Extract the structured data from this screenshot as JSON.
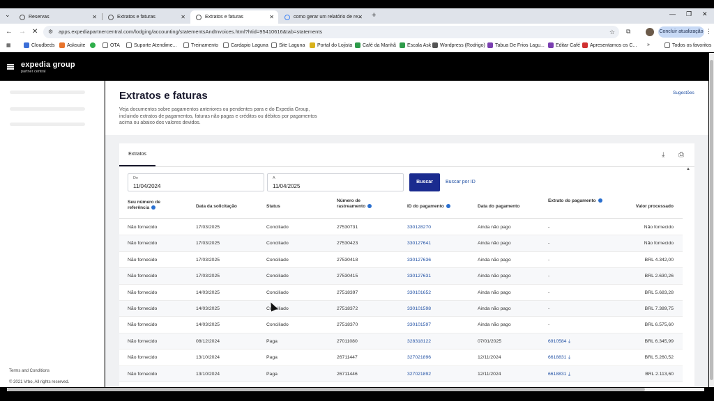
{
  "browser": {
    "tabs": [
      {
        "title": "Reservas"
      },
      {
        "title": "Extratos e faturas"
      },
      {
        "title": "Extratos e faturas"
      },
      {
        "title": "como gerar um relatório de re..."
      }
    ],
    "new_tab_icon": "plus-icon",
    "url": "apps.expediapartnercentral.com/lodging/accounting/statementsAndInvoices.html?htid=95410616&tab=statements",
    "update_button": "Concluir atualização",
    "bookmarks": [
      {
        "label": "Cloudbeds",
        "color": "#3b6fd8"
      },
      {
        "label": "Asksuite",
        "color": "#e8742c"
      },
      {
        "label": "",
        "color": "#2fae4a"
      },
      {
        "label": "OTA",
        "color": "#666666"
      },
      {
        "label": "Suporte Atendime...",
        "color": "#666666"
      },
      {
        "label": "Treinamento",
        "color": "#666666"
      },
      {
        "label": "Cardapio Laguna",
        "color": "#666666"
      },
      {
        "label": "Site Laguna",
        "color": "#666666"
      },
      {
        "label": "Portal do Lojista",
        "color": "#d9b21c"
      },
      {
        "label": "Café da Manhã",
        "color": "#2e9b4a"
      },
      {
        "label": "Escala Ask",
        "color": "#2e9b4a"
      },
      {
        "label": "Wordpress (Rodrigo)",
        "color": "#555555"
      },
      {
        "label": "Tabua De Frios Lagu...",
        "color": "#7a3fb0"
      },
      {
        "label": "Editar Café",
        "color": "#7a3fb0"
      },
      {
        "label": "Apresentamos os C...",
        "color": "#d03030"
      }
    ],
    "bookmarks_overflow": "»",
    "all_favorites": "Todos os favoritos"
  },
  "app": {
    "brand": "expedia group",
    "brand_sub": "partner central"
  },
  "sidebar": {
    "terms": "Terms and Conditions",
    "copyright": "© 2021 Vrbo, All rights reserved."
  },
  "page": {
    "title": "Extratos e faturas",
    "description": "Veja documentos sobre pagamentos anteriores ou pendentes para e do Expedia Group, incluindo extratos de pagamentos, faturas não pagas e créditos ou débitos por pagamentos acima ou abaixo dos valores devidos.",
    "suggestions_link": "Sugestões"
  },
  "card": {
    "tab_label": "Extratos",
    "from_label": "De",
    "from_value": "11/04/2024",
    "to_label": "A",
    "to_value": "11/04/2025",
    "search_button": "Buscar",
    "search_by_id": "Buscar por ID"
  },
  "table": {
    "headers": [
      "Seu número de referência",
      "Data da solicitação",
      "Status",
      "Número de rastreamento",
      "ID do pagamento",
      "Data do pagamento",
      "Extrato do pagamento",
      "Valor processado"
    ],
    "rows": [
      [
        "Não fornecido",
        "17/03/2025",
        "Conciliado",
        "27530731",
        "330128270",
        "Ainda não pago",
        "-",
        "Não fornecido"
      ],
      [
        "Não fornecido",
        "17/03/2025",
        "Conciliado",
        "27530423",
        "330127641",
        "Ainda não pago",
        "-",
        "Não fornecido"
      ],
      [
        "Não fornecido",
        "17/03/2025",
        "Conciliado",
        "27530418",
        "330127636",
        "Ainda não pago",
        "-",
        "BRL 4.342,00"
      ],
      [
        "Não fornecido",
        "17/03/2025",
        "Conciliado",
        "27530415",
        "330127631",
        "Ainda não pago",
        "-",
        "BRL 2.630,26"
      ],
      [
        "Não fornecido",
        "14/03/2025",
        "Conciliado",
        "27518397",
        "330101652",
        "Ainda não pago",
        "-",
        "BRL 5.683,28"
      ],
      [
        "Não fornecido",
        "14/03/2025",
        "Conciliado",
        "27518372",
        "330101598",
        "Ainda não pago",
        "-",
        "BRL 7.389,75"
      ],
      [
        "Não fornecido",
        "14/03/2025",
        "Conciliado",
        "27518370",
        "330101597",
        "Ainda não pago",
        "-",
        "BRL 6.575,60"
      ],
      [
        "Não fornecido",
        "08/12/2024",
        "Paga",
        "27011080",
        "328318122",
        "07/01/2025",
        "6910584",
        "BRL 6.345,99"
      ],
      [
        "Não fornecido",
        "13/10/2024",
        "Paga",
        "26711447",
        "327021896",
        "12/11/2024",
        "6618831",
        "BRL 5.260,52"
      ],
      [
        "Não fornecido",
        "13/10/2024",
        "Paga",
        "26711446",
        "327021892",
        "12/11/2024",
        "6618831",
        "BRL 2.113,60"
      ]
    ]
  }
}
